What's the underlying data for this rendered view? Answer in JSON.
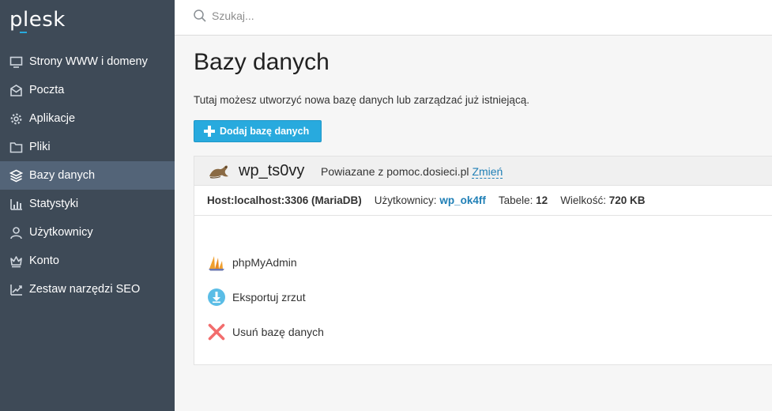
{
  "app": {
    "logo_text": "plesk"
  },
  "sidebar": {
    "items": [
      {
        "label": "Strony WWW i domeny",
        "icon": "monitor-icon",
        "active": false
      },
      {
        "label": "Poczta",
        "icon": "mail-icon",
        "active": false
      },
      {
        "label": "Aplikacje",
        "icon": "gear-icon",
        "active": false
      },
      {
        "label": "Pliki",
        "icon": "folder-icon",
        "active": false
      },
      {
        "label": "Bazy danych",
        "icon": "layers-icon",
        "active": true
      },
      {
        "label": "Statystyki",
        "icon": "bar-chart-icon",
        "active": false
      },
      {
        "label": "Użytkownicy",
        "icon": "user-icon",
        "active": false
      },
      {
        "label": "Konto",
        "icon": "crown-icon",
        "active": false
      },
      {
        "label": "Zestaw narzędzi SEO",
        "icon": "seo-chart-icon",
        "active": false
      }
    ]
  },
  "search": {
    "placeholder": "Szukaj...",
    "value": ""
  },
  "main": {
    "title": "Bazy danych",
    "description": "Tutaj możesz utworzyć nowa bazę danych lub zarządzać już istniejącą.",
    "add_button_label": "Dodaj bazę danych"
  },
  "database": {
    "name": "wp_ts0vy",
    "related_prefix": "Powiazane z pomoc.dosieci.pl",
    "change_link": "Zmień",
    "host_label": "Host:localhost:3306 (MariaDB)",
    "users_label": "Użytkownicy:",
    "users_value": "wp_ok4ff",
    "tables_label": "Tabele:",
    "tables_value": "12",
    "size_label": "Wielkość:",
    "size_value": "720 KB"
  },
  "actions": [
    {
      "label": "phpMyAdmin",
      "icon": "phpmyadmin-icon"
    },
    {
      "label": "Eksportuj zrzut",
      "icon": "download-icon"
    },
    {
      "label": "Usuń bazę danych",
      "icon": "delete-x-icon"
    }
  ],
  "colors": {
    "sidebar_bg": "#3e4a57",
    "sidebar_active": "#536478",
    "accent": "#28aade",
    "link": "#1f7fb6",
    "delete": "#f26d6d"
  }
}
